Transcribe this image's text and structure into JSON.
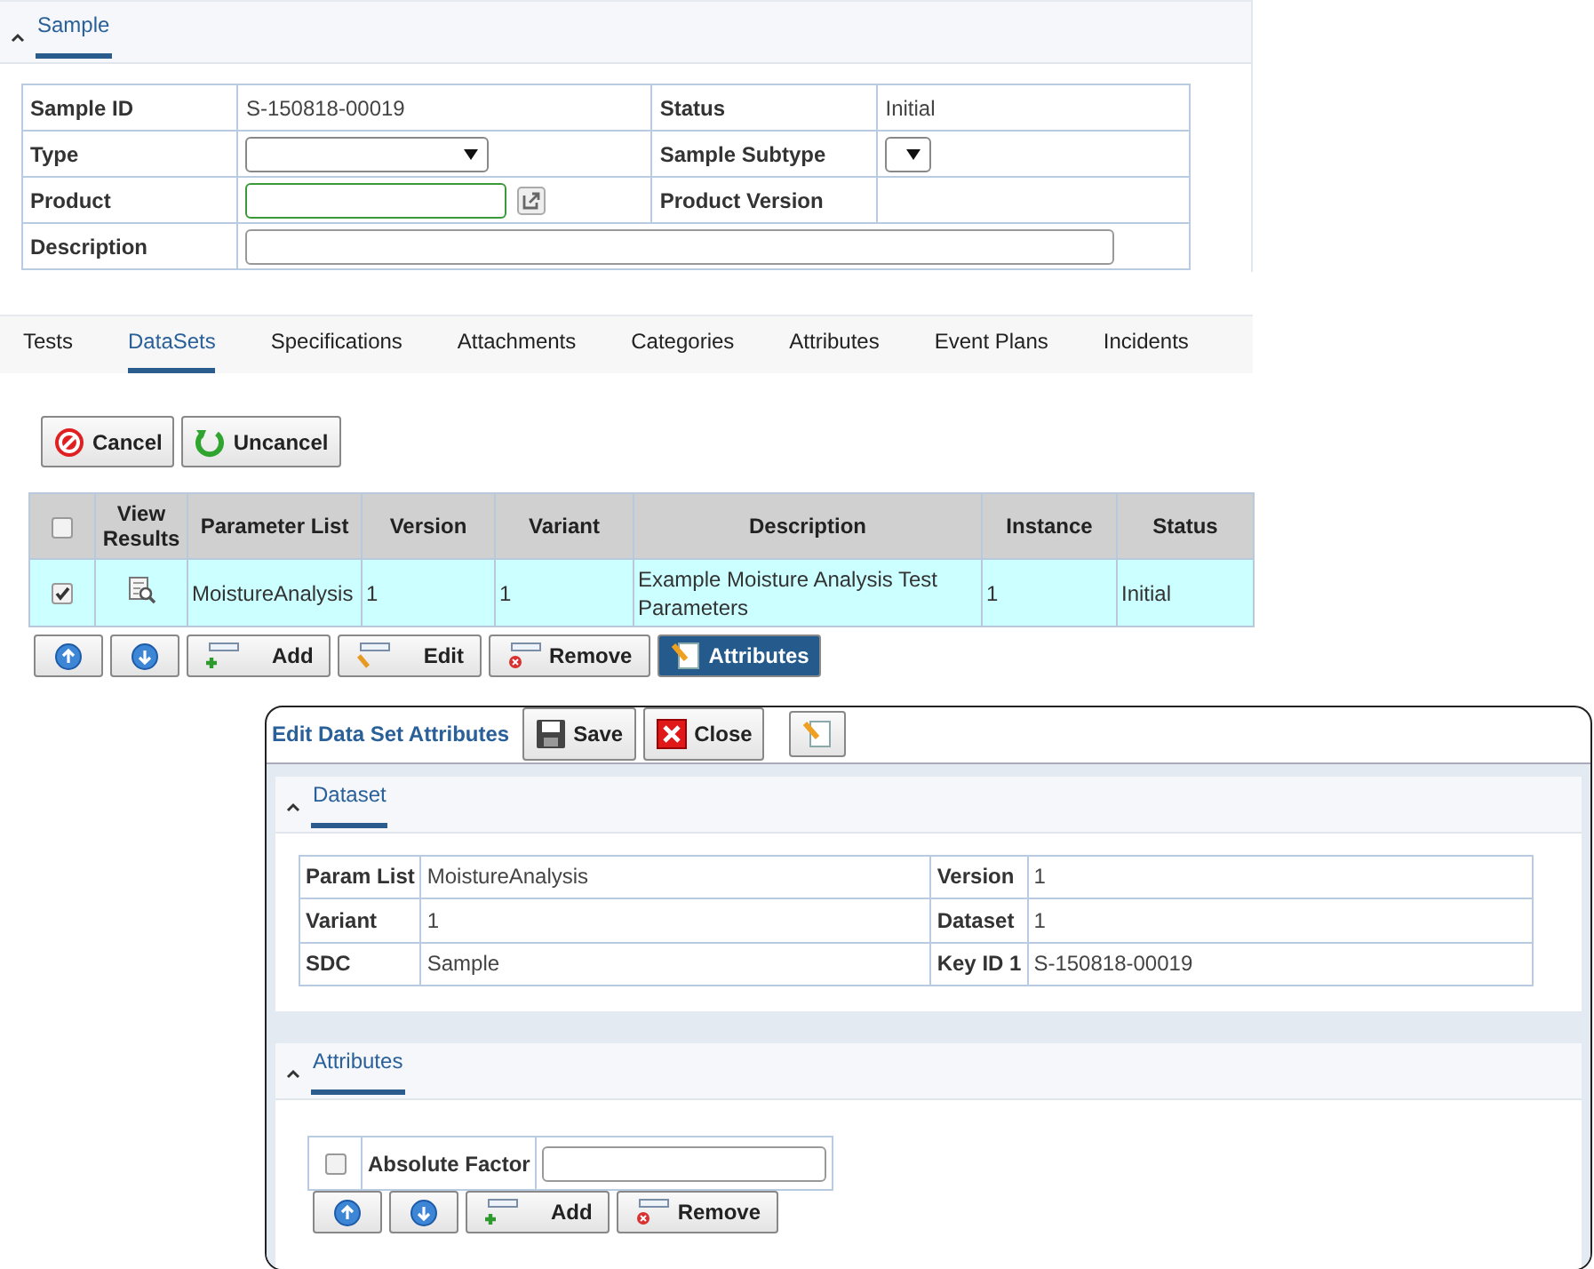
{
  "sample_section": {
    "title": "Sample",
    "rows": [
      {
        "cells": [
          {
            "label": "Sample ID",
            "kind": "text",
            "value": "S-150818-00019"
          },
          {
            "label": "Status",
            "kind": "text",
            "value": "Initial"
          }
        ]
      },
      {
        "cells": [
          {
            "label": "Type",
            "kind": "select"
          },
          {
            "label": "Sample Subtype",
            "kind": "mini_select"
          }
        ]
      },
      {
        "cells": [
          {
            "label": "Product",
            "kind": "lookup"
          },
          {
            "label": "Product Version",
            "kind": "empty"
          }
        ]
      },
      {
        "cells": [
          {
            "label": "Description",
            "kind": "input"
          }
        ]
      }
    ]
  },
  "tabs": [
    {
      "label": "Tests",
      "selected": false
    },
    {
      "label": "DataSets",
      "selected": true
    },
    {
      "label": "Specifications",
      "selected": false
    },
    {
      "label": "Attachments",
      "selected": false
    },
    {
      "label": "Categories",
      "selected": false
    },
    {
      "label": "Attributes",
      "selected": false
    },
    {
      "label": "Event Plans",
      "selected": false
    },
    {
      "label": "Incidents",
      "selected": false
    }
  ],
  "actions": [
    {
      "kind": "cancel",
      "label": "Cancel"
    },
    {
      "kind": "uncancel",
      "label": "Uncancel"
    }
  ],
  "grid": {
    "header_checked": false,
    "columns": [
      "View Results",
      "Parameter List",
      "Version",
      "Variant",
      "Description",
      "Instance",
      "Status"
    ],
    "rows": [
      {
        "selected": true,
        "checked": true,
        "cells": [
          {
            "kind": "view"
          },
          {
            "kind": "text",
            "text": "MoistureAnalysis"
          },
          {
            "kind": "text",
            "text": "1"
          },
          {
            "kind": "text",
            "text": "1"
          },
          {
            "kind": "text",
            "text": "Example Moisture Analysis Test Parameters"
          },
          {
            "kind": "text",
            "text": "1"
          },
          {
            "kind": "text",
            "text": "Initial"
          }
        ]
      }
    ]
  },
  "grid_toolbar": [
    {
      "kind": "up"
    },
    {
      "kind": "down"
    },
    {
      "kind": "add",
      "label": "Add"
    },
    {
      "kind": "edit",
      "label": "Edit"
    },
    {
      "kind": "remove",
      "label": "Remove"
    },
    {
      "kind": "attributes",
      "label": "Attributes"
    }
  ],
  "dialog": {
    "title": "Edit Data Set Attributes",
    "buttons": [
      {
        "kind": "save",
        "label": "Save"
      },
      {
        "kind": "close",
        "label": "Close"
      },
      {
        "kind": "notes"
      }
    ],
    "dataset_section": {
      "title": "Dataset",
      "rows": [
        [
          {
            "label": "Param List",
            "value": "MoistureAnalysis"
          },
          {
            "label": "Version",
            "value": "1"
          }
        ],
        [
          {
            "label": "Variant",
            "value": "1"
          },
          {
            "label": "Dataset",
            "value": "1"
          }
        ],
        [
          {
            "label": "SDC",
            "value": "Sample"
          },
          {
            "label": "Key ID 1",
            "value": "S-150818-00019"
          }
        ]
      ]
    },
    "attributes_section": {
      "title": "Attributes",
      "rows": [
        {
          "checked": false,
          "label": "Absolute Factor"
        }
      ],
      "toolbar": [
        {
          "kind": "up"
        },
        {
          "kind": "down"
        },
        {
          "kind": "add",
          "label": "Add"
        },
        {
          "kind": "remove",
          "label": "Remove"
        }
      ]
    }
  }
}
